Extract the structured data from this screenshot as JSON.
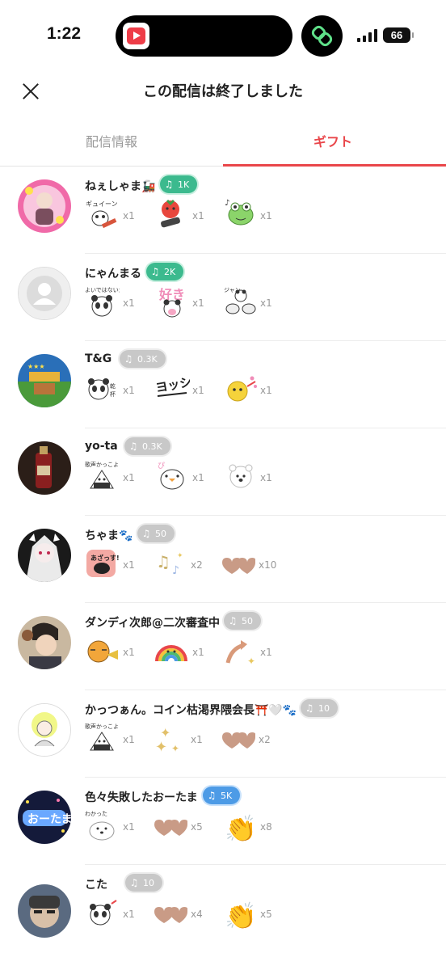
{
  "status_bar": {
    "time": "1:22",
    "battery": "66"
  },
  "header": {
    "title": "この配信は終了しました"
  },
  "tabs": [
    {
      "label": "配信情報",
      "active": false
    },
    {
      "label": "ギフト",
      "active": true
    }
  ],
  "colors": {
    "accent": "#e9464a",
    "pill_green": "#3cba8e",
    "pill_blue": "#4d9be6",
    "pill_gray": "#c8c8c8"
  },
  "supporters": [
    {
      "name": "ねぇしゃま🚂",
      "score": "1K",
      "gifts": [
        {
          "icon": "guitar-sticker",
          "count": "x1"
        },
        {
          "icon": "tomato-guitar-sticker",
          "count": "x1"
        },
        {
          "icon": "frog-dance-sticker",
          "count": "x1"
        }
      ]
    },
    {
      "name": "にゃんまる",
      "score": "2K",
      "gifts": [
        {
          "icon": "panda-sticker",
          "count": "x1"
        },
        {
          "icon": "suki-panda-sticker",
          "count": "x1"
        },
        {
          "icon": "drums-panda-sticker",
          "count": "x1"
        }
      ]
    },
    {
      "name": "T&G",
      "score": "0.3K",
      "gifts": [
        {
          "icon": "panda-sticker",
          "count": "x1"
        },
        {
          "icon": "yossha-sticker",
          "count": "x1"
        },
        {
          "icon": "yellow-bird-sticker",
          "count": "x1"
        }
      ]
    },
    {
      "name": "yo-ta",
      "score": "0.3K",
      "gifts": [
        {
          "icon": "onigiri-sticker",
          "count": "x1"
        },
        {
          "icon": "bird-sticker",
          "count": "x1"
        },
        {
          "icon": "bear-sticker",
          "count": "x1"
        }
      ]
    },
    {
      "name": "ちゃま🐾",
      "score": "50",
      "gifts": [
        {
          "icon": "bird-shout-sticker",
          "count": "x1"
        },
        {
          "icon": "music-notes-sticker",
          "count": "x2"
        },
        {
          "icon": "heart-sticker",
          "count": "x10"
        }
      ]
    },
    {
      "name": "ダンディ次郎@二次審査中",
      "score": "50",
      "gifts": [
        {
          "icon": "tiger-trumpet-sticker",
          "count": "x1"
        },
        {
          "icon": "rainbow-sticker",
          "count": "x1"
        },
        {
          "icon": "arrow-sparkle-sticker",
          "count": "x1"
        }
      ]
    },
    {
      "name": "かっつぁん。コイン枯渇界隈会長⛩️🤍🐾",
      "score": "10",
      "gifts": [
        {
          "icon": "onigiri-sticker",
          "count": "x1"
        },
        {
          "icon": "sparkle-sticker",
          "count": "x1"
        },
        {
          "icon": "heart-sticker",
          "count": "x2"
        }
      ]
    },
    {
      "name": "色々失敗したおーたま",
      "score": "5K",
      "gifts": [
        {
          "icon": "seal-sticker",
          "count": "x1"
        },
        {
          "icon": "heart-sticker",
          "count": "x5"
        },
        {
          "icon": "clap-sticker",
          "count": "x8"
        }
      ]
    },
    {
      "name": "こた",
      "score": "10",
      "gifts": [
        {
          "icon": "panda-sticker",
          "count": "x1"
        },
        {
          "icon": "heart-sticker",
          "count": "x4"
        },
        {
          "icon": "clap-sticker",
          "count": "x5"
        }
      ]
    }
  ]
}
